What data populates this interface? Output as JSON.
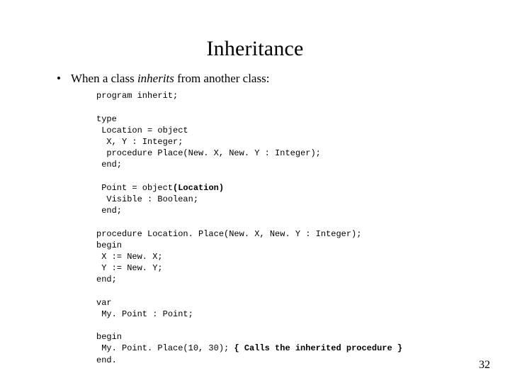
{
  "title": "Inheritance",
  "bullet": {
    "marker": "•",
    "pre": "When a class ",
    "italic": "inherits",
    "post": " from another class:"
  },
  "code": {
    "l01": "program inherit;",
    "l02": "",
    "l03": "type",
    "l04": " Location = object",
    "l05": "  X, Y : Integer;",
    "l06": "  procedure Place(New. X, New. Y : Integer);",
    "l07": " end;",
    "l08": "",
    "l09_a": " Point = object",
    "l09_b": "(Location)",
    "l10": "  Visible : Boolean;",
    "l11": " end;",
    "l12": "",
    "l13": "procedure Location. Place(New. X, New. Y : Integer);",
    "l14": "begin",
    "l15": " X := New. X;",
    "l16": " Y := New. Y;",
    "l17": "end;",
    "l18": "",
    "l19": "var",
    "l20": " My. Point : Point;",
    "l21": "",
    "l22": "begin",
    "l23_a": " My. Point. Place(10, 30); ",
    "l23_b": "{ Calls the inherited procedure }",
    "l24": "end."
  },
  "page_number": "32"
}
